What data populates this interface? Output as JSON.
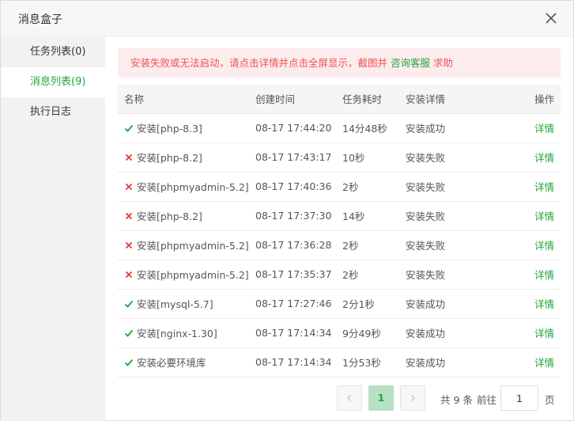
{
  "dialog": {
    "title": "消息盒子"
  },
  "sidebar": {
    "items": [
      {
        "label": "任务列表(0)"
      },
      {
        "label": "消息列表(9)"
      },
      {
        "label": "执行日志"
      }
    ]
  },
  "alert": {
    "message": "安装失败或无法启动，请点击详情并点击全屏显示，截图并 ",
    "link": "咨询客服",
    "tail": " 求助"
  },
  "table": {
    "headers": [
      "名称",
      "创建时间",
      "任务耗时",
      "安装详情",
      "操作"
    ],
    "rows": [
      {
        "status": "success",
        "name": "安装[php-8.3]",
        "time": "08-17 17:44:20",
        "duration": "14分48秒",
        "result": "安装成功",
        "action": "详情"
      },
      {
        "status": "fail",
        "name": "安装[php-8.2]",
        "time": "08-17 17:43:17",
        "duration": "10秒",
        "result": "安装失败",
        "action": "详情"
      },
      {
        "status": "fail",
        "name": "安装[phpmyadmin-5.2]",
        "time": "08-17 17:40:36",
        "duration": "2秒",
        "result": "安装失败",
        "action": "详情"
      },
      {
        "status": "fail",
        "name": "安装[php-8.2]",
        "time": "08-17 17:37:30",
        "duration": "14秒",
        "result": "安装失败",
        "action": "详情"
      },
      {
        "status": "fail",
        "name": "安装[phpmyadmin-5.2]",
        "time": "08-17 17:36:28",
        "duration": "2秒",
        "result": "安装失败",
        "action": "详情"
      },
      {
        "status": "fail",
        "name": "安装[phpmyadmin-5.2]",
        "time": "08-17 17:35:37",
        "duration": "2秒",
        "result": "安装失败",
        "action": "详情"
      },
      {
        "status": "success",
        "name": "安装[mysql-5.7]",
        "time": "08-17 17:27:46",
        "duration": "2分1秒",
        "result": "安装成功",
        "action": "详情"
      },
      {
        "status": "success",
        "name": "安装[nginx-1.30]",
        "time": "08-17 17:14:34",
        "duration": "9分49秒",
        "result": "安装成功",
        "action": "详情"
      },
      {
        "status": "success",
        "name": "安装必要环境库",
        "time": "08-17 17:14:34",
        "duration": "1分53秒",
        "result": "安装成功",
        "action": "详情"
      }
    ]
  },
  "pagination": {
    "current_page": "1",
    "total_text": "共 9 条",
    "goto_label": "前往",
    "goto_value": "1",
    "page_unit": "页"
  },
  "colors": {
    "accent": "#20a53a",
    "error": "#e53935",
    "alert_bg": "#fdecee"
  },
  "icons": {
    "success": "check-icon",
    "fail": "cross-icon",
    "close": "close-icon",
    "prev": "chevron-left-icon",
    "next": "chevron-right-icon"
  }
}
